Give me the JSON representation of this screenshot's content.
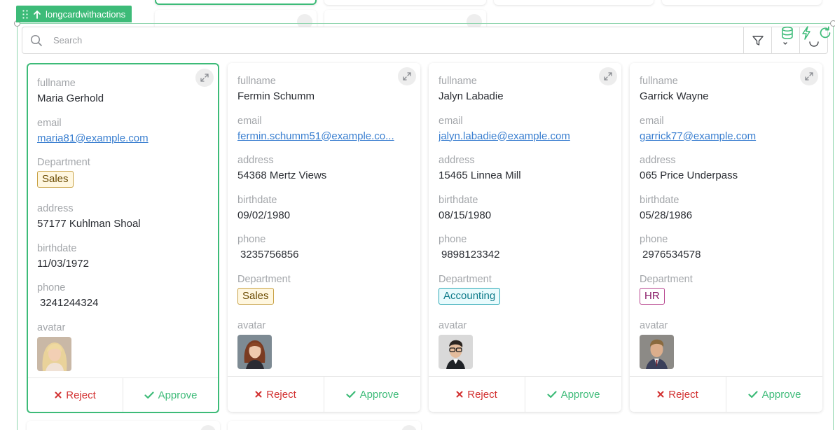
{
  "component_tag": {
    "label": "longcardwithactions"
  },
  "search": {
    "placeholder": "Search"
  },
  "toolbar": {
    "icons": [
      "search-icon",
      "filter-icon",
      "sort-icon",
      "refresh-icon"
    ],
    "status_icons": [
      "database-icon",
      "lightning-icon",
      "refresh-icon"
    ]
  },
  "colors": {
    "accent": "#3dbb78",
    "reject": "#d23030",
    "link": "#3a7fd0",
    "sales_badge": "#c8a144",
    "accounting_badge": "#2aa7b5",
    "hr_badge": "#b8468f"
  },
  "cards": [
    {
      "fullname_label": "fullname",
      "fullname": "Maria Gerhold",
      "email_label": "email",
      "email": "maria81@example.com",
      "department_label": "Department",
      "department": "Sales",
      "address_label": "address",
      "address": "57177 Kuhlman Shoal",
      "birthdate_label": "birthdate",
      "birthdate": "11/03/1972",
      "phone_label": "phone",
      "phone": "3241244324",
      "avatar_label": "avatar",
      "reject_label": "Reject",
      "approve_label": "Approve"
    },
    {
      "fullname_label": "fullname",
      "fullname": "Fermin Schumm",
      "email_label": "email",
      "email": "fermin.schumm51@example.co...",
      "address_label": "address",
      "address": "54368 Mertz Views",
      "birthdate_label": "birthdate",
      "birthdate": "09/02/1980",
      "phone_label": "phone",
      "phone": "3235756856",
      "department_label": "Department",
      "department": "Sales",
      "avatar_label": "avatar",
      "reject_label": "Reject",
      "approve_label": "Approve"
    },
    {
      "fullname_label": "fullname",
      "fullname": "Jalyn Labadie",
      "email_label": "email",
      "email": "jalyn.labadie@example.com",
      "address_label": "address",
      "address": "15465 Linnea Mill",
      "birthdate_label": "birthdate",
      "birthdate": "08/15/1980",
      "phone_label": "phone",
      "phone": "9898123342",
      "department_label": "Department",
      "department": "Accounting",
      "avatar_label": "avatar",
      "reject_label": "Reject",
      "approve_label": "Approve"
    },
    {
      "fullname_label": "fullname",
      "fullname": "Garrick Wayne",
      "email_label": "email",
      "email": "garrick77@example.com",
      "address_label": "address",
      "address": "065 Price Underpass",
      "birthdate_label": "birthdate",
      "birthdate": "05/28/1986",
      "phone_label": "phone",
      "phone": "2976534578",
      "department_label": "Department",
      "department": "HR",
      "avatar_label": "avatar",
      "reject_label": "Reject",
      "approve_label": "Approve"
    }
  ]
}
